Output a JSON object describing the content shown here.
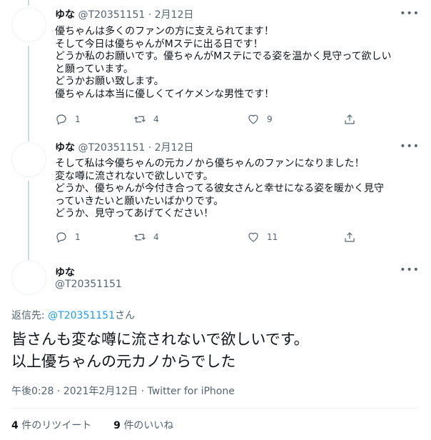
{
  "tweets": [
    {
      "name": "ゆな",
      "handle": "@T20351151",
      "date": "2月12日",
      "lines": [
        "優ちゃんは多くのファンの方に支えられてます！",
        "そして今日は優ちゃんがMステに出る日です！",
        "どうか私のお願いです。優ちゃんがMステにでる姿を温かく見守って欲しい",
        "と願っています。",
        "どうかお願い致します。",
        "優ちゃんは本当に優しくてイケメンな男性です！"
      ],
      "replies": "1",
      "retweets": "4",
      "likes": "9"
    },
    {
      "name": "ゆな",
      "handle": "@T20351151",
      "date": "2月12日",
      "lines": [
        "そして私は今優ちゃんの元カノから優ちゃんのファンになりました！",
        "変な噂に流されないで欲しいです。",
        "どうか、優ちゃんが今付き合ってる彼女さんと幸せになる姿を暖かく見守",
        "っていきたいと願いたいばかりです。",
        "どうか、見守ってあげてください！"
      ],
      "replies": "1",
      "retweets": "4",
      "likes": "11"
    }
  ],
  "main": {
    "name": "ゆな",
    "handle": "@T20351151",
    "reply_prefix": "返信先: ",
    "reply_handle": "@T20351151",
    "reply_suffix": "さん",
    "lines": [
      "皆さんも変な噂に流されないで欲しいです。",
      "以上優ちゃんの元カノからでした"
    ],
    "time": "午後0:28 · 2021年2月12日 · ",
    "client": "Twitter for iPhone",
    "retweet_count": "4",
    "retweet_label": "件のリツイート",
    "like_count": "9",
    "like_label": "件のいいね"
  },
  "icons": {
    "more": "more-horizontal-icon",
    "reply": "reply-bubble-icon",
    "retweet": "retweet-arrows-icon",
    "like": "heart-icon",
    "share": "share-upload-icon"
  },
  "colors": {
    "text": "#0f1419",
    "muted": "#536471",
    "link": "#1d9bf0",
    "border": "#eff3f4"
  }
}
